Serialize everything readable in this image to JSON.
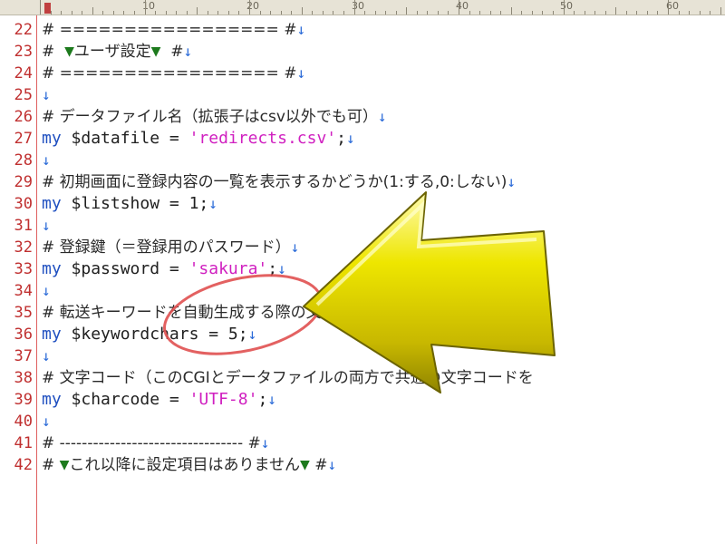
{
  "ruler": {
    "labels": [
      "10",
      "20",
      "30",
      "40",
      "50",
      "60"
    ]
  },
  "lines": [
    {
      "no": "22",
      "text": "# ================= #",
      "nl": "↓"
    },
    {
      "no": "23",
      "pre": "#  ",
      "tri_a": "▼",
      "text": "ユーザ設定",
      "tri_b": "▼",
      "post": "  #",
      "nl": "↓"
    },
    {
      "no": "24",
      "text": "# ================= #",
      "nl": "↓"
    },
    {
      "no": "25",
      "text": "",
      "nl": "↓"
    },
    {
      "no": "26",
      "text": "# データファイル名（拡張子はcsv以外でも可）",
      "nl": "↓"
    },
    {
      "no": "27",
      "kw": "my",
      "var": "$datafile = ",
      "str": "'redirects.csv'",
      "rest": ";",
      "nl": "↓"
    },
    {
      "no": "28",
      "text": "",
      "nl": "↓"
    },
    {
      "no": "29",
      "text": "# 初期画面に登録内容の一覧を表示するかどうか(1:する,0:しない)",
      "nl": "↓"
    },
    {
      "no": "30",
      "kw": "my",
      "var": "$listshow = 1;",
      "nl": "↓"
    },
    {
      "no": "31",
      "text": "",
      "nl": "↓"
    },
    {
      "no": "32",
      "text": "# 登録鍵（＝登録用のパスワード）",
      "nl": "↓"
    },
    {
      "no": "33",
      "kw": "my",
      "var": "$password = ",
      "str": "'sakura'",
      "rest": ";",
      "nl": "↓"
    },
    {
      "no": "34",
      "text": "",
      "nl": "↓"
    },
    {
      "no": "35",
      "text": "# 転送キーワードを自動生成する際の文字数(1以上の数値)",
      "nl": "↓"
    },
    {
      "no": "36",
      "kw": "my",
      "var": "$keywordchars = 5;",
      "nl": "↓"
    },
    {
      "no": "37",
      "text": "",
      "nl": "↓"
    },
    {
      "no": "38",
      "text": "# 文字コード（このCGIとデータファイルの両方で共通の文字コードを",
      "nl": ""
    },
    {
      "no": "39",
      "kw": "my",
      "var": "$charcode = ",
      "str": "'UTF-8'",
      "rest": ";",
      "nl": "↓"
    },
    {
      "no": "40",
      "text": "",
      "nl": "↓"
    },
    {
      "no": "41",
      "text": "# --------------------------------- #",
      "nl": "↓"
    },
    {
      "no": "42",
      "pre": "# ",
      "tri_a": "▼",
      "text": "これ以降に設定項目はありません",
      "tri_b": "▼",
      "post": " #",
      "nl": "↓"
    }
  ],
  "colors": {
    "keyword": "#2050c0",
    "string": "#d020c0",
    "line_number": "#c03030",
    "arrow_fill": "#e8e000",
    "highlight_circle": "#e05050"
  },
  "icons": {
    "arrow": "big-yellow-left-arrow",
    "circle": "red-highlight-circle"
  }
}
